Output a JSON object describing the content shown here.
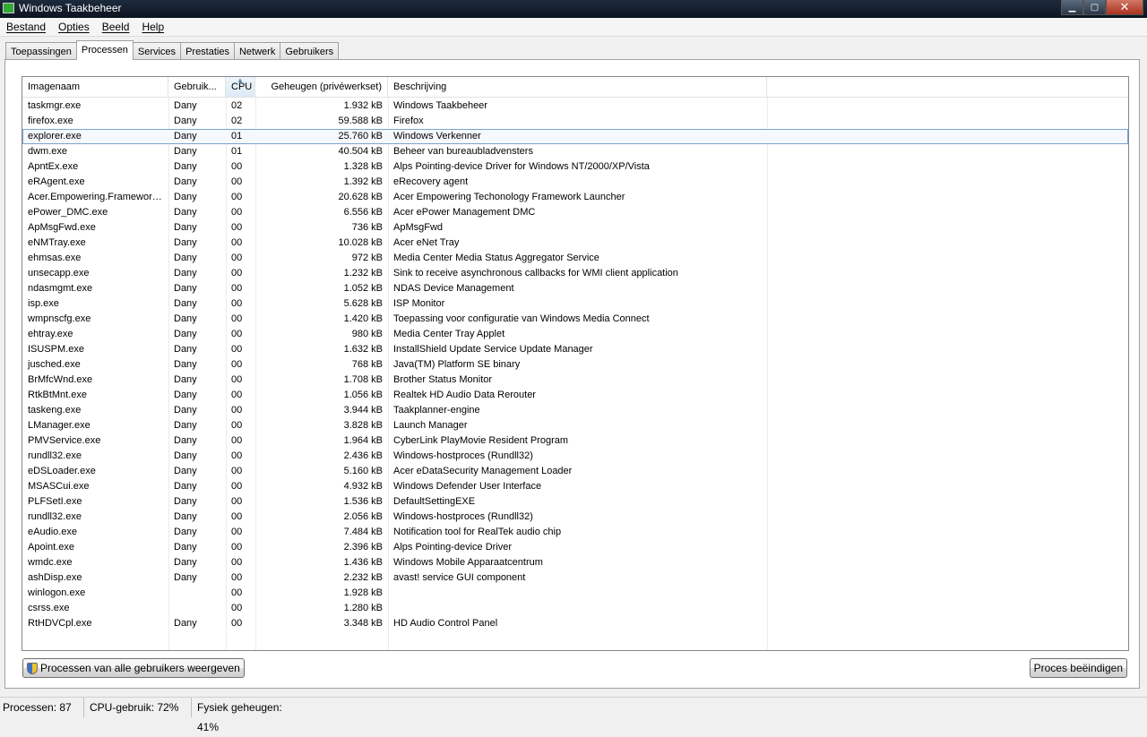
{
  "window": {
    "title": "Windows Taakbeheer",
    "min": "▁",
    "max": "▢",
    "close": "✕"
  },
  "menu": [
    "Bestand",
    "Opties",
    "Beeld",
    "Help"
  ],
  "tabs": [
    "Toepassingen",
    "Processen",
    "Services",
    "Prestaties",
    "Netwerk",
    "Gebruikers"
  ],
  "active_tab": "Processen",
  "columns": [
    "Imagenaam",
    "Gebruik...",
    "CPU",
    "Geheugen (privéwerkset)",
    "Beschrijving"
  ],
  "sorted_column": "CPU",
  "selected_row": 2,
  "processes": [
    {
      "name": "taskmgr.exe",
      "user": "Dany",
      "cpu": "02",
      "mem": "1.932 kB",
      "desc": "Windows Taakbeheer"
    },
    {
      "name": "firefox.exe",
      "user": "Dany",
      "cpu": "02",
      "mem": "59.588 kB",
      "desc": "Firefox"
    },
    {
      "name": "explorer.exe",
      "user": "Dany",
      "cpu": "01",
      "mem": "25.760 kB",
      "desc": "Windows Verkenner"
    },
    {
      "name": "dwm.exe",
      "user": "Dany",
      "cpu": "01",
      "mem": "40.504 kB",
      "desc": "Beheer van bureaubladvensters"
    },
    {
      "name": "ApntEx.exe",
      "user": "Dany",
      "cpu": "00",
      "mem": "1.328 kB",
      "desc": "Alps Pointing-device Driver for Windows NT/2000/XP/Vista"
    },
    {
      "name": "eRAgent.exe",
      "user": "Dany",
      "cpu": "00",
      "mem": "1.392 kB",
      "desc": "eRecovery agent"
    },
    {
      "name": "Acer.Empowering.Framework...",
      "user": "Dany",
      "cpu": "00",
      "mem": "20.628 kB",
      "desc": "Acer Empowering Techonology Framework Launcher"
    },
    {
      "name": "ePower_DMC.exe",
      "user": "Dany",
      "cpu": "00",
      "mem": "6.556 kB",
      "desc": "Acer ePower Management DMC"
    },
    {
      "name": "ApMsgFwd.exe",
      "user": "Dany",
      "cpu": "00",
      "mem": "736 kB",
      "desc": "ApMsgFwd"
    },
    {
      "name": "eNMTray.exe",
      "user": "Dany",
      "cpu": "00",
      "mem": "10.028 kB",
      "desc": "Acer eNet Tray"
    },
    {
      "name": "ehmsas.exe",
      "user": "Dany",
      "cpu": "00",
      "mem": "972 kB",
      "desc": "Media Center Media Status Aggregator Service"
    },
    {
      "name": "unsecapp.exe",
      "user": "Dany",
      "cpu": "00",
      "mem": "1.232 kB",
      "desc": "Sink to receive asynchronous callbacks for WMI client application"
    },
    {
      "name": "ndasmgmt.exe",
      "user": "Dany",
      "cpu": "00",
      "mem": "1.052 kB",
      "desc": "NDAS Device Management"
    },
    {
      "name": "isp.exe",
      "user": "Dany",
      "cpu": "00",
      "mem": "5.628 kB",
      "desc": "ISP Monitor"
    },
    {
      "name": "wmpnscfg.exe",
      "user": "Dany",
      "cpu": "00",
      "mem": "1.420 kB",
      "desc": "Toepassing voor configuratie van Windows Media Connect"
    },
    {
      "name": "ehtray.exe",
      "user": "Dany",
      "cpu": "00",
      "mem": "980 kB",
      "desc": "Media Center Tray Applet"
    },
    {
      "name": "ISUSPM.exe",
      "user": "Dany",
      "cpu": "00",
      "mem": "1.632 kB",
      "desc": "InstallShield Update Service Update Manager"
    },
    {
      "name": "jusched.exe",
      "user": "Dany",
      "cpu": "00",
      "mem": "768 kB",
      "desc": "Java(TM) Platform SE binary"
    },
    {
      "name": "BrMfcWnd.exe",
      "user": "Dany",
      "cpu": "00",
      "mem": "1.708 kB",
      "desc": "Brother Status Monitor"
    },
    {
      "name": "RtkBtMnt.exe",
      "user": "Dany",
      "cpu": "00",
      "mem": "1.056 kB",
      "desc": "Realtek HD Audio Data Rerouter"
    },
    {
      "name": "taskeng.exe",
      "user": "Dany",
      "cpu": "00",
      "mem": "3.944 kB",
      "desc": "Taakplanner-engine"
    },
    {
      "name": "LManager.exe",
      "user": "Dany",
      "cpu": "00",
      "mem": "3.828 kB",
      "desc": "Launch Manager"
    },
    {
      "name": "PMVService.exe",
      "user": "Dany",
      "cpu": "00",
      "mem": "1.964 kB",
      "desc": "CyberLink PlayMovie Resident Program"
    },
    {
      "name": "rundll32.exe",
      "user": "Dany",
      "cpu": "00",
      "mem": "2.436 kB",
      "desc": "Windows-hostproces (Rundll32)"
    },
    {
      "name": "eDSLoader.exe",
      "user": "Dany",
      "cpu": "00",
      "mem": "5.160 kB",
      "desc": "Acer eDataSecurity Management Loader"
    },
    {
      "name": "MSASCui.exe",
      "user": "Dany",
      "cpu": "00",
      "mem": "4.932 kB",
      "desc": "Windows Defender User Interface"
    },
    {
      "name": "PLFSetI.exe",
      "user": "Dany",
      "cpu": "00",
      "mem": "1.536 kB",
      "desc": "DefaultSettingEXE"
    },
    {
      "name": "rundll32.exe",
      "user": "Dany",
      "cpu": "00",
      "mem": "2.056 kB",
      "desc": "Windows-hostproces (Rundll32)"
    },
    {
      "name": "eAudio.exe",
      "user": "Dany",
      "cpu": "00",
      "mem": "7.484 kB",
      "desc": "Notification tool for RealTek audio chip"
    },
    {
      "name": "Apoint.exe",
      "user": "Dany",
      "cpu": "00",
      "mem": "2.396 kB",
      "desc": "Alps Pointing-device Driver"
    },
    {
      "name": "wmdc.exe",
      "user": "Dany",
      "cpu": "00",
      "mem": "1.436 kB",
      "desc": "Windows Mobile Apparaatcentrum"
    },
    {
      "name": "ashDisp.exe",
      "user": "Dany",
      "cpu": "00",
      "mem": "2.232 kB",
      "desc": "avast! service GUI component"
    },
    {
      "name": "winlogon.exe",
      "user": "",
      "cpu": "00",
      "mem": "1.928 kB",
      "desc": ""
    },
    {
      "name": "csrss.exe",
      "user": "",
      "cpu": "00",
      "mem": "1.280 kB",
      "desc": ""
    },
    {
      "name": "RtHDVCpl.exe",
      "user": "Dany",
      "cpu": "00",
      "mem": "3.348 kB",
      "desc": "HD Audio Control Panel"
    }
  ],
  "buttons": {
    "show_all": "Processen van alle gebruikers weergeven",
    "end_process": "Proces beëindigen"
  },
  "status": {
    "processes": "Processen: 87",
    "cpu": "CPU-gebruik: 72%",
    "memory": "Fysiek geheugen: 41%"
  },
  "colors": {
    "titlebar": "#1d2b3e",
    "selection_border": "#7da2ce",
    "close_button": "#c0452f"
  }
}
